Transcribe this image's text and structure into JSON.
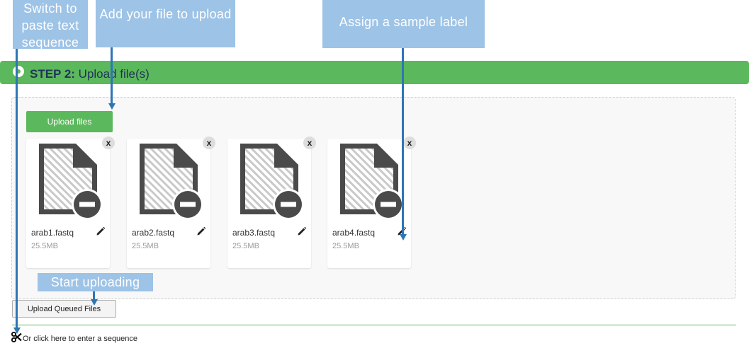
{
  "step": {
    "label": "STEP 2:",
    "title": " Upload file(s)"
  },
  "upload_files_button": "Upload files",
  "remove_label": "x",
  "files": [
    {
      "name": "arab1.fastq",
      "size": "25.5MB"
    },
    {
      "name": "arab2.fastq",
      "size": "25.5MB"
    },
    {
      "name": "arab3.fastq",
      "size": "25.5MB"
    },
    {
      "name": "arab4.fastq",
      "size": "25.5MB"
    }
  ],
  "upload_queued_button": "Upload Queued Files",
  "sequence_link": "Or click here to enter a sequence",
  "annotations": {
    "switch": "Switch to paste text sequence",
    "add_file": "Add your file to upload",
    "assign": "Assign a sample label",
    "start": "Start uploading"
  },
  "colors": {
    "step_bar": "#5cb85c",
    "callout": "#9dc3e6",
    "arrow": "#2e75b6"
  },
  "icons": {
    "file": "file-icon",
    "remove_badge": "remove-badge-icon",
    "edit": "pencil-icon",
    "remove_file": "close-icon",
    "sequence": "scissors-icon"
  }
}
